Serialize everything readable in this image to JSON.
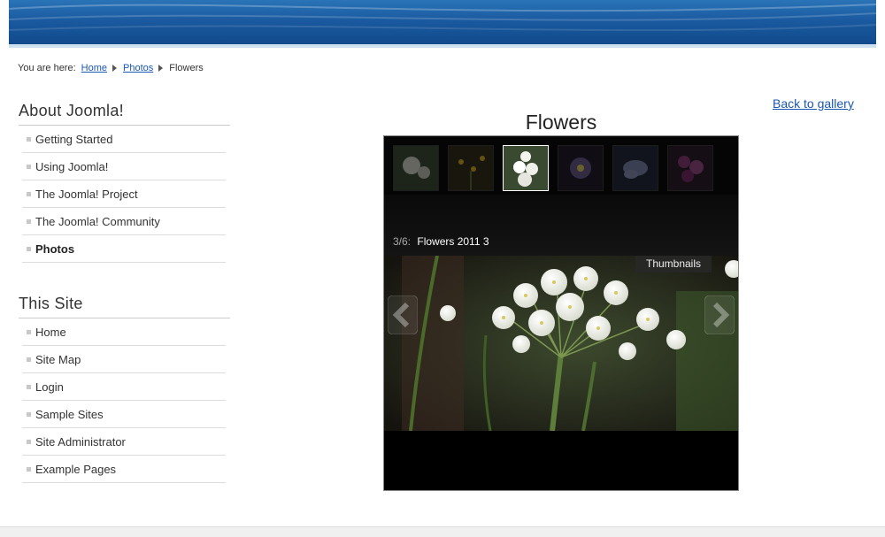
{
  "breadcrumb": {
    "prefix": "You are here:",
    "items": [
      "Home",
      "Photos"
    ],
    "current": "Flowers"
  },
  "modules": [
    {
      "title": "About Joomla!",
      "items": [
        "Getting Started",
        "Using Joomla!",
        "The Joomla! Project",
        "The Joomla! Community",
        "Photos"
      ],
      "active_index": 4
    },
    {
      "title": "This Site",
      "items": [
        "Home",
        "Site Map",
        "Login",
        "Sample Sites",
        "Site Administrator",
        "Example Pages"
      ]
    }
  ],
  "main": {
    "back_link": "Back to gallery",
    "title": "Flowers"
  },
  "gallery": {
    "counter": "3/6:",
    "caption": "Flowers 2011 3",
    "thumbnails_button": "Thumbnails",
    "active_thumbnail": 3,
    "thumbnail_count": 6
  },
  "colors": {
    "link": "#1b57b1",
    "header": "#1a5aa0",
    "gallery_bg": "#000000"
  }
}
